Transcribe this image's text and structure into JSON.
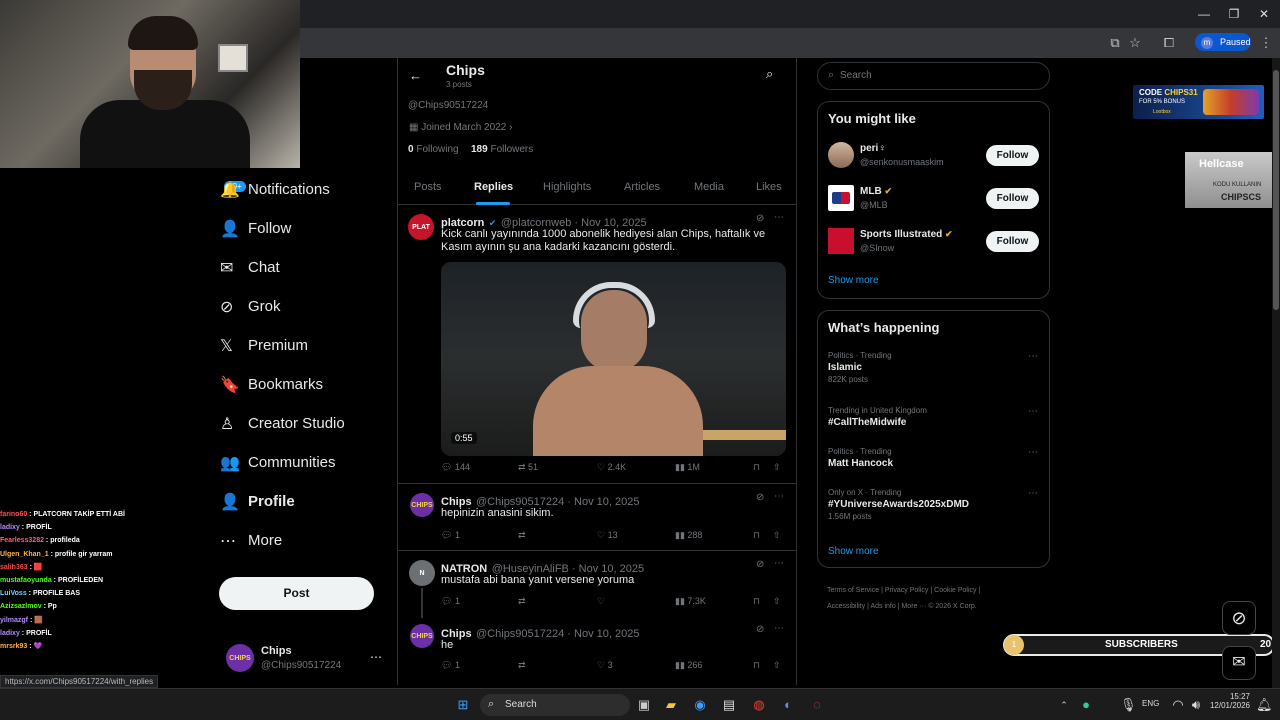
{
  "browser": {
    "paused_label": "Paused",
    "profile_initial": "m",
    "status_url": "https://x.com/Chips90517224/with_replies"
  },
  "stream_overlay": {
    "promo_code_line1": "CODE",
    "promo_code_name": "CHIPS31",
    "promo_code_line2": "FOR 5% BONUS",
    "promo_site": "Lootbox",
    "promo2_brand": "Hellcase",
    "promo2_line1": "KODU KULLANIN",
    "promo2_line2": "CHIPSCS",
    "subscribers_label": "SUBSCRIBERS",
    "subscribers_current": "1",
    "subscribers_goal": "20"
  },
  "chat": [
    {
      "user": "farino60",
      "msg": "PLATCORN TAKİP ETTİ ABİ",
      "color": "#ff4e4e"
    },
    {
      "user": "ladixy",
      "msg": "PROFİL",
      "color": "#b38bff"
    },
    {
      "user": "Fearless3282",
      "msg": "profileda",
      "color": "#ff5c8a"
    },
    {
      "user": "Ulgen_Khan_1",
      "msg": "profile gir yarram",
      "color": "#ffb347"
    },
    {
      "user": "salih363",
      "msg": "🟥",
      "color": "#ff4e4e"
    },
    {
      "user": "mustafaoyunda",
      "msg": "PROFİLEDEN",
      "color": "#53fc18"
    },
    {
      "user": "LuiVoss",
      "msg": "PROFILE BAS",
      "color": "#6fd4ff"
    },
    {
      "user": "Azizsazlmov",
      "msg": "Pp",
      "color": "#53fc18"
    },
    {
      "user": "yilmazgf",
      "msg": "🟫",
      "color": "#b38bff"
    },
    {
      "user": "ladixy",
      "msg": "PROFİL",
      "color": "#b38bff"
    },
    {
      "user": "mrsrk93",
      "msg": "💜",
      "color": "#ffb347"
    }
  ],
  "sidebar": {
    "notif_badge": "20+",
    "items": [
      {
        "label": "Notifications",
        "icon": "bell-icon",
        "glyph": "🔔"
      },
      {
        "label": "Follow",
        "icon": "follow-icon",
        "glyph": "👤"
      },
      {
        "label": "Chat",
        "icon": "mail-icon",
        "glyph": "✉"
      },
      {
        "label": "Grok",
        "icon": "grok-icon",
        "glyph": "⊘"
      },
      {
        "label": "Premium",
        "icon": "x-icon",
        "glyph": "𝕏"
      },
      {
        "label": "Bookmarks",
        "icon": "bookmark-icon",
        "glyph": "🔖"
      },
      {
        "label": "Creator Studio",
        "icon": "creator-icon",
        "glyph": "♙"
      },
      {
        "label": "Communities",
        "icon": "communities-icon",
        "glyph": "👥"
      },
      {
        "label": "Profile",
        "icon": "profile-icon",
        "glyph": "👤"
      },
      {
        "label": "More",
        "icon": "more-icon",
        "glyph": "⋯"
      }
    ],
    "post_label": "Post",
    "account_name": "Chips",
    "account_handle": "@Chips90517224"
  },
  "profile": {
    "header_name": "Chips",
    "header_posts": "3 posts",
    "handle": "@Chips90517224",
    "joined": "Joined March 2022",
    "following_count": "0",
    "following_label": "Following",
    "followers_count": "189",
    "followers_label": "Followers",
    "tabs": [
      "Posts",
      "Replies",
      "Highlights",
      "Articles",
      "Media",
      "Likes"
    ]
  },
  "tweets": [
    {
      "name": "platcorn",
      "handle": "@platcornweb",
      "date": "Nov 10, 2025",
      "text": "Kick canlı yayınında 1000 abonelik hediyesi alan Chips, haftalık ve Kasım ayının şu ana kadarki kazancını gösterdi.",
      "video_time": "0:55",
      "replies": "144",
      "reposts": "51",
      "likes": "2.4K",
      "views": "1M"
    },
    {
      "name": "Chips",
      "handle": "@Chips90517224",
      "date": "Nov 10, 2025",
      "text": "hepinizin anasini sikim.",
      "replies": "1",
      "reposts": "",
      "likes": "13",
      "views": "288"
    },
    {
      "name": "NATRON",
      "handle": "@HuseyinAliFB",
      "date": "Nov 10, 2025",
      "text": "mustafa abi bana yanıt versene yoruma",
      "replies": "1",
      "reposts": "",
      "likes": "",
      "views": "7.3K"
    },
    {
      "name": "Chips",
      "handle": "@Chips90517224",
      "date": "Nov 10, 2025",
      "text": "he",
      "replies": "1",
      "reposts": "",
      "likes": "3",
      "views": "266"
    }
  ],
  "right": {
    "search_placeholder": "Search",
    "might_like_title": "You might like",
    "suggestions": [
      {
        "name": "peri♀",
        "handle": "@senkonusmaaskim",
        "follow": "Follow"
      },
      {
        "name": "MLB",
        "handle": "@MLB",
        "follow": "Follow"
      },
      {
        "name": "Sports Illustrated",
        "handle": "@SInow",
        "follow": "Follow"
      }
    ],
    "show_more": "Show more",
    "happening_title": "What’s happening",
    "trends": [
      {
        "cat": "Politics · Trending",
        "title": "Islamic",
        "count": "822K posts"
      },
      {
        "cat": "Trending in United Kingdom",
        "title": "#CallTheMidwife",
        "count": ""
      },
      {
        "cat": "Politics · Trending",
        "title": "Matt Hancock",
        "count": ""
      },
      {
        "cat": "Only on X · Trending",
        "title": "#YUniverseAwards2025xDMD",
        "count": "1.56M posts"
      }
    ],
    "footer": [
      "Terms of Service",
      "Privacy Policy",
      "Cookie Policy",
      "Accessibility",
      "Ads info",
      "More ···",
      "© 2026 X Corp."
    ]
  },
  "taskbar": {
    "search": "Search",
    "lang": "ENG",
    "time": "15:27",
    "date": "12/01/2026"
  },
  "colors": {
    "accent": "#1d9bf0",
    "bg": "#000000",
    "border": "#2f3336",
    "muted": "#71767b"
  }
}
